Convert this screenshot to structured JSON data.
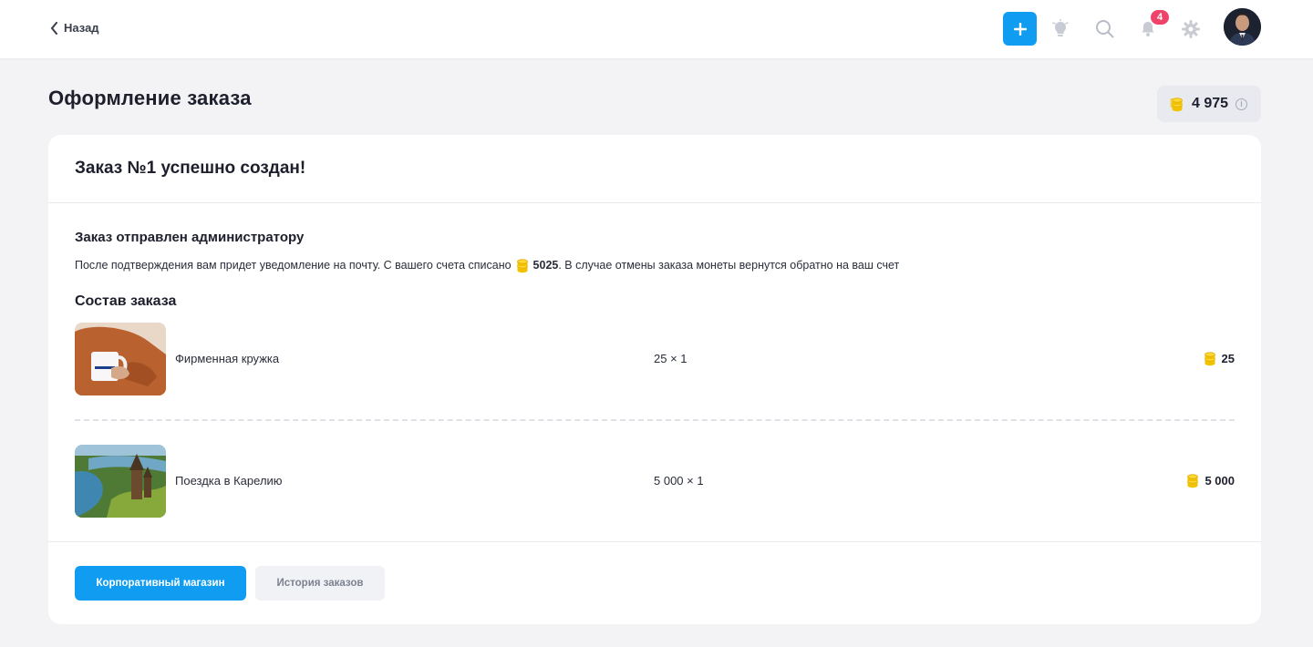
{
  "header": {
    "back_label": "Назад",
    "notifications_count": "4",
    "colors": {
      "accent": "#109cf1",
      "badge": "#f0436a"
    },
    "icons": [
      "plus-icon",
      "lightbulb-icon",
      "search-icon",
      "bell-icon",
      "gear-icon"
    ]
  },
  "page": {
    "title": "Оформление заказа",
    "balance": "4 975"
  },
  "order": {
    "title": "Заказ №1 успешно создан!",
    "sent_title": "Заказ отправлен администратору",
    "sent_text_before": "После подтверждения вам придет уведомление на почту. С вашего счета списано",
    "sent_amount": "5025",
    "sent_text_after": ". В случае отмены заказа монеты вернутся обратно на ваш счет",
    "composition_title": "Состав заказа",
    "items": [
      {
        "name": "Фирменная кружка",
        "qty": "25 × 1",
        "price": "25"
      },
      {
        "name": "Поездка в Карелию",
        "qty": "5 000 × 1",
        "price": "5 000"
      }
    ],
    "buttons": {
      "shop": "Корпоративный магазин",
      "history": "История заказов"
    }
  }
}
